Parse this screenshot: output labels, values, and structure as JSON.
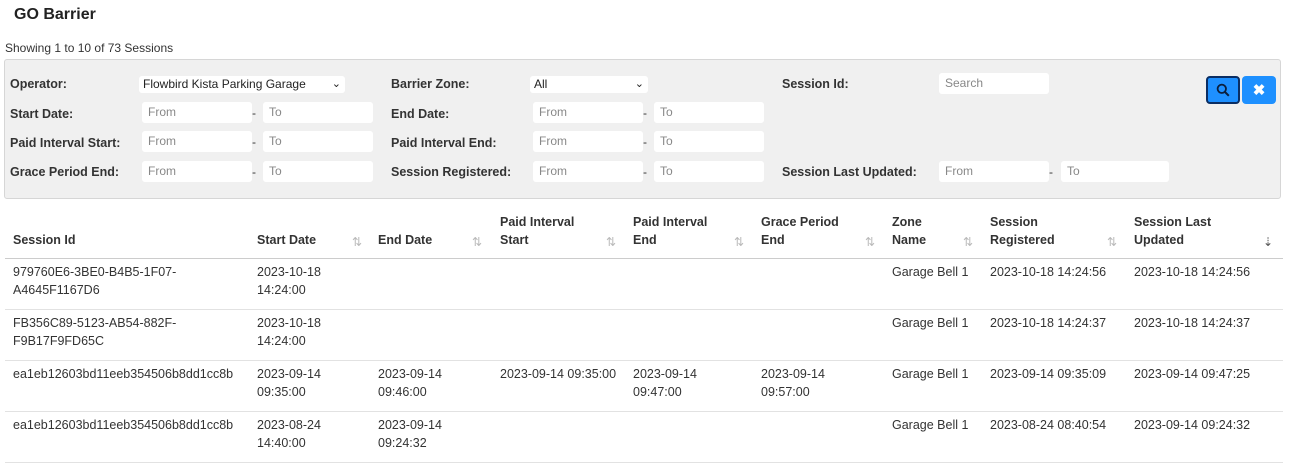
{
  "page": {
    "title": "GO Barrier",
    "showing": "Showing 1 to 10 of 73 Sessions"
  },
  "filters": {
    "operator_label": "Operator:",
    "operator_value": "Flowbird Kista Parking Garage",
    "barrier_zone_label": "Barrier Zone:",
    "barrier_zone_value": "All",
    "session_id_label": "Session Id:",
    "session_id_placeholder": "Search",
    "start_date_label": "Start Date:",
    "end_date_label": "End Date:",
    "paid_start_label": "Paid Interval Start:",
    "paid_end_label": "Paid Interval End:",
    "grace_end_label": "Grace Period End:",
    "session_registered_label": "Session Registered:",
    "session_updated_label": "Session Last Updated:",
    "from": "From",
    "to": "To",
    "dash": "-"
  },
  "buttons": {
    "search_icon": "search-icon",
    "clear_icon": "close-icon"
  },
  "table": {
    "headers": [
      {
        "line1": "Session Id",
        "line2": ""
      },
      {
        "line1": "Start Date",
        "line2": ""
      },
      {
        "line1": "End Date",
        "line2": ""
      },
      {
        "line1": "Paid Interval",
        "line2": "Start"
      },
      {
        "line1": "Paid Interval",
        "line2": "End"
      },
      {
        "line1": "Grace Period",
        "line2": "End"
      },
      {
        "line1": "Zone",
        "line2": "Name"
      },
      {
        "line1": "Session",
        "line2": "Registered"
      },
      {
        "line1": "Session Last",
        "line2": "Updated"
      }
    ],
    "rows": [
      [
        "979760E6-3BE0-B4B5-1F07-\nA4645F1167D6",
        "2023-10-18\n14:24:00",
        "",
        "",
        "",
        "",
        "Garage Bell 1",
        "2023-10-18 14:24:56",
        "2023-10-18 14:24:56"
      ],
      [
        "FB356C89-5123-AB54-882F-\nF9B17F9FD65C",
        "2023-10-18\n14:24:00",
        "",
        "",
        "",
        "",
        "Garage Bell 1",
        "2023-10-18 14:24:37",
        "2023-10-18 14:24:37"
      ],
      [
        "ea1eb12603bd11eeb354506b8dd1cc8b",
        "2023-09-14\n09:35:00",
        "2023-09-14\n09:46:00",
        "2023-09-14 09:35:00",
        "2023-09-14\n09:47:00",
        "2023-09-14\n09:57:00",
        "Garage Bell 1",
        "2023-09-14 09:35:09",
        "2023-09-14 09:47:25"
      ],
      [
        "ea1eb12603bd11eeb354506b8dd1cc8b",
        "2023-08-24\n14:40:00",
        "2023-09-14\n09:24:32",
        "",
        "",
        "",
        "Garage Bell 1",
        "2023-08-24 08:40:54",
        "2023-09-14 09:24:32"
      ]
    ]
  }
}
